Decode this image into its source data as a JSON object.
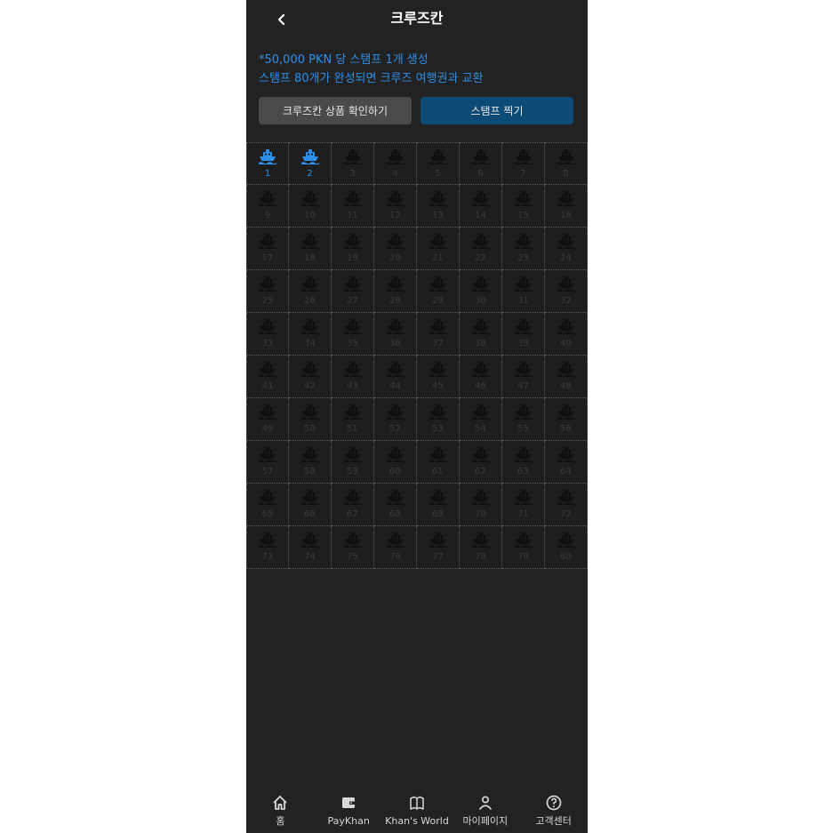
{
  "header": {
    "title": "크루즈칸",
    "back_icon": "chevron-left-icon"
  },
  "info": {
    "line1": "*50,000 PKN 당 스탬프 1개 생성",
    "line2": "스탬프 80개가 완성되면 크루즈 여행권과 교환"
  },
  "buttons": {
    "products_label": "크루즈칸 상품 확인하기",
    "stamp_label": "스탬프 찍기"
  },
  "stamps": {
    "total": 80,
    "completed": 2,
    "icon": "ship-icon",
    "active_color": "#2f8fe8",
    "inactive_color": "#101010"
  },
  "tabbar": {
    "items": [
      {
        "label": "홈",
        "icon": "home-icon"
      },
      {
        "label": "PayKhan",
        "icon": "wallet-icon"
      },
      {
        "label": "Khan's World",
        "icon": "map-book-icon"
      },
      {
        "label": "마이페이지",
        "icon": "person-icon"
      },
      {
        "label": "고객센터",
        "icon": "help-icon"
      }
    ]
  },
  "colors": {
    "accent": "#2f8fe8",
    "primary_button": "#0d4a75",
    "secondary_button": "#4a4a4a",
    "background": "#222222"
  }
}
